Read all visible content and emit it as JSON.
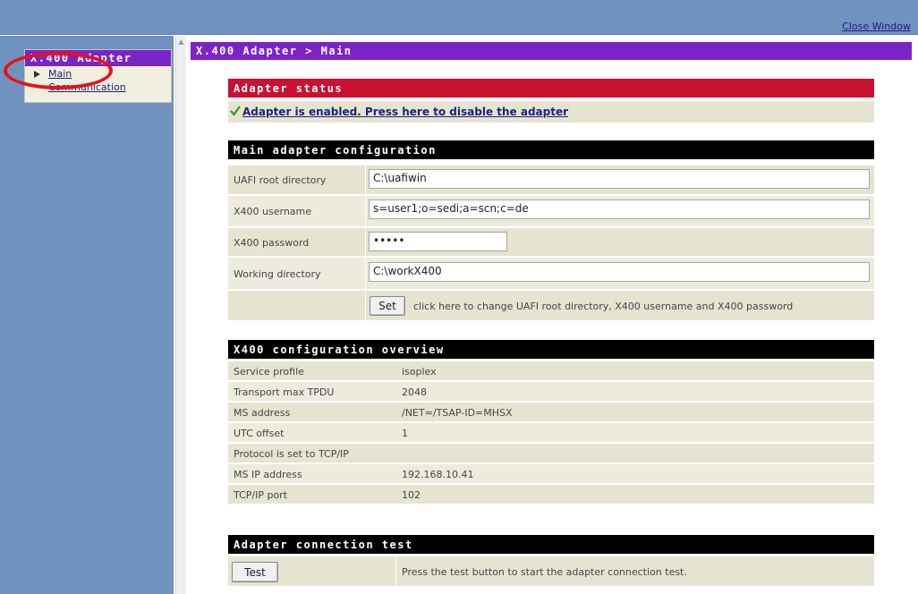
{
  "top": {
    "close_window": "Close Window"
  },
  "sidebar": {
    "title": "X.400 Adapter",
    "items": [
      {
        "label": "Main"
      },
      {
        "label": "Communication"
      }
    ]
  },
  "header": {
    "breadcrumb": "X.400 Adapter > Main"
  },
  "status": {
    "title": "Adapter status",
    "link": "Adapter is enabled. Press here to disable the adapter",
    "icon": "checkmark-icon"
  },
  "config": {
    "title": "Main adapter configuration",
    "fields": [
      {
        "label": "UAFI root directory",
        "value": "C:\\uafiwin"
      },
      {
        "label": "X400 username",
        "value": "s=user1;o=sedi;a=scn;c=de"
      },
      {
        "label": "X400 password",
        "value": "•••••"
      },
      {
        "label": "Working directory",
        "value": "C:\\workX400"
      }
    ],
    "set_button": "Set",
    "set_hint": "click here to change UAFI root directory, X400 username and X400 password"
  },
  "overview": {
    "title": "X400 configuration overview",
    "rows": [
      {
        "label": "Service profile",
        "value": "isoplex"
      },
      {
        "label": "Transport max TPDU",
        "value": "2048"
      },
      {
        "label": "MS address",
        "value": "/NET=/TSAP-ID=MHSX"
      },
      {
        "label": "UTC offset",
        "value": "1"
      },
      {
        "label": "Protocol is set to TCP/IP",
        "value": ""
      },
      {
        "label": "MS IP address",
        "value": "192.168.10.41"
      },
      {
        "label": "TCP/IP port",
        "value": "102"
      }
    ]
  },
  "test": {
    "title": "Adapter connection test",
    "button": "Test",
    "hint": "Press the test button to start the adapter connection test."
  },
  "colors": {
    "frame_blue": "#7092be",
    "header_purple": "#7a24c8",
    "status_red": "#cc1030",
    "row_beige": "#e6e4d1",
    "annotation_red": "#e8101a"
  }
}
